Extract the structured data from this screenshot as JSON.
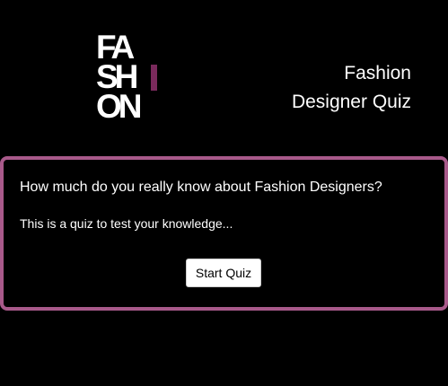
{
  "logo": {
    "row1": "FA",
    "row2": "SH",
    "row3": "ON",
    "accent_color": "#7a2a5c"
  },
  "header": {
    "title_line1": "Fashion",
    "title_line2": "Designer Quiz"
  },
  "card": {
    "heading": "How much do you really know about Fashion Designers?",
    "text": "This is a quiz to test your knowledge...",
    "button_label": "Start Quiz",
    "border_color": "#a8598a"
  }
}
